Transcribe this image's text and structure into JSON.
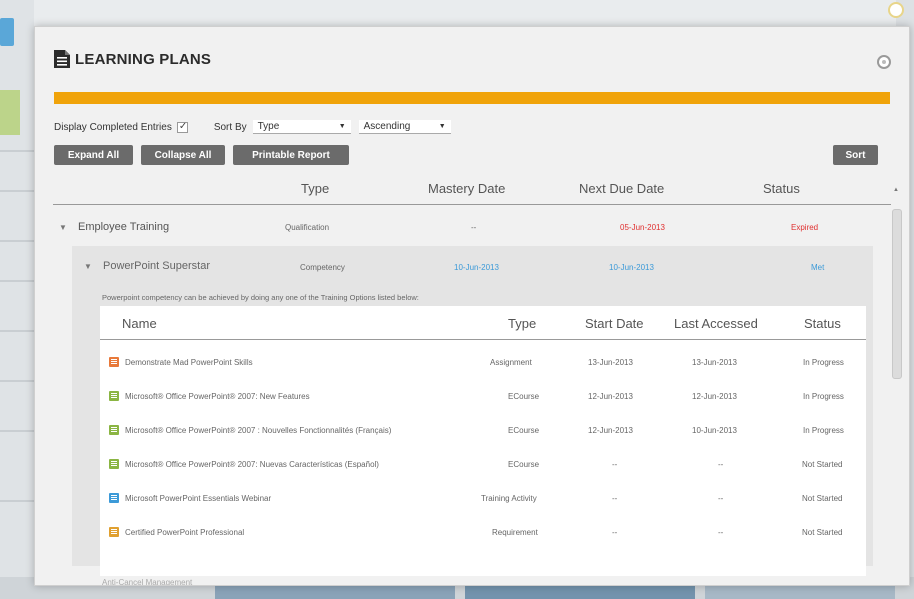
{
  "modal": {
    "title": "LEARNING PLANS",
    "progress_color": "#f0a30a",
    "controls": {
      "display_completed_label": "Display Completed Entries",
      "display_completed_checked": true,
      "sort_by_label": "Sort By",
      "sort_field": "Type",
      "sort_order": "Ascending"
    },
    "buttons": {
      "expand_all": "Expand All",
      "collapse_all": "Collapse All",
      "printable_report": "Printable Report",
      "sort": "Sort"
    },
    "columns": {
      "type": "Type",
      "mastery_date": "Mastery Date",
      "next_due_date": "Next Due Date",
      "status": "Status"
    },
    "plan": {
      "name": "Employee Training",
      "type": "Qualification",
      "mastery_date": "--",
      "next_due_date": "05-Jun-2013",
      "status": "Expired"
    },
    "competency": {
      "name": "PowerPoint Superstar",
      "type": "Competency",
      "mastery_date": "10-Jun-2013",
      "next_due_date": "10-Jun-2013",
      "status": "Met",
      "note": "Powerpoint competency can be achieved by doing any one of the Training Options listed below:"
    },
    "options_table": {
      "headers": {
        "name": "Name",
        "type": "Type",
        "start_date": "Start Date",
        "last_accessed": "Last Accessed",
        "status": "Status"
      },
      "rows": [
        {
          "icon": "assignment-icon",
          "icon_color": "#e8793a",
          "name": "Demonstrate Mad PowerPoint Skills",
          "type": "Assignment",
          "start_date": "13-Jun-2013",
          "last_accessed": "13-Jun-2013",
          "status": "In Progress"
        },
        {
          "icon": "ecourse-icon",
          "icon_color": "#8bb543",
          "name": "Microsoft® Office PowerPoint® 2007: New Features",
          "type": "ECourse",
          "start_date": "12-Jun-2013",
          "last_accessed": "12-Jun-2013",
          "status": "In Progress"
        },
        {
          "icon": "ecourse-icon",
          "icon_color": "#8bb543",
          "name": "Microsoft® Office PowerPoint® 2007 : Nouvelles Fonctionnalités (Français)",
          "type": "ECourse",
          "start_date": "12-Jun-2013",
          "last_accessed": "10-Jun-2013",
          "status": "In Progress"
        },
        {
          "icon": "ecourse-icon",
          "icon_color": "#8bb543",
          "name": "Microsoft® Office PowerPoint® 2007: Nuevas Características (Español)",
          "type": "ECourse",
          "start_date": "--",
          "last_accessed": "--",
          "status": "Not Started"
        },
        {
          "icon": "webinar-icon",
          "icon_color": "#3c9ad8",
          "name": "Microsoft PowerPoint Essentials Webinar",
          "type": "Training Activity",
          "start_date": "--",
          "last_accessed": "--",
          "status": "Not Started"
        },
        {
          "icon": "requirement-icon",
          "icon_color": "#e0a030",
          "name": "Certified PowerPoint Professional",
          "type": "Requirement",
          "start_date": "--",
          "last_accessed": "--",
          "status": "Not Started"
        }
      ]
    },
    "next_item": "Anti-Cancel Management"
  }
}
